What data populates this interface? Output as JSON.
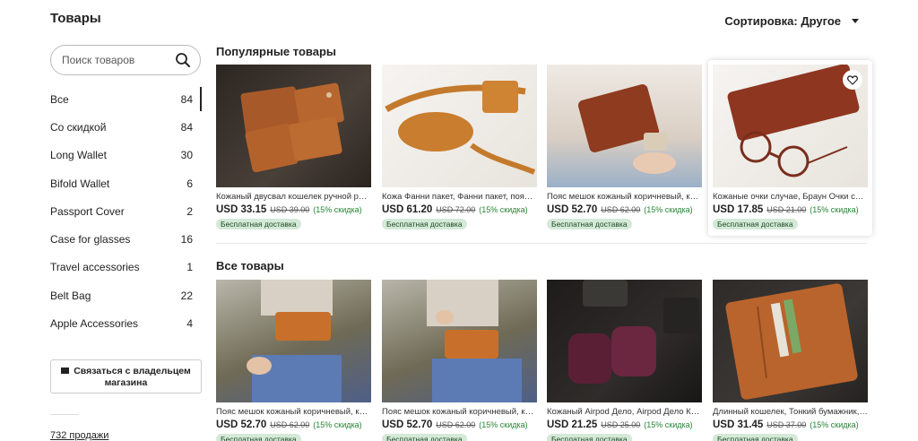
{
  "header": {
    "title": "Товары",
    "sort_label": "Сортировка: Другое"
  },
  "search": {
    "placeholder": "Поиск товаров"
  },
  "categories": [
    {
      "name": "Все",
      "count": "84",
      "active": true
    },
    {
      "name": "Со скидкой",
      "count": "84"
    },
    {
      "name": "Long Wallet",
      "count": "30"
    },
    {
      "name": "Bifold Wallet",
      "count": "6"
    },
    {
      "name": "Passport Cover",
      "count": "2"
    },
    {
      "name": "Case for glasses",
      "count": "16"
    },
    {
      "name": "Travel accessories",
      "count": "1"
    },
    {
      "name": "Belt Bag",
      "count": "22"
    },
    {
      "name": "Apple Accessories",
      "count": "4"
    }
  ],
  "contact": {
    "label": "Связаться с владельцем магазина"
  },
  "sales": {
    "label": "732 продажи"
  },
  "sections": {
    "popular": "Популярные товары",
    "all": "Все товары"
  },
  "popular_items": [
    {
      "title": "Кожаный двусвал кошелек ручной работы",
      "price": "USD 33.15",
      "old_price": "USD 39.00",
      "discount": "(15% скидка)",
      "badge": "Бесплатная доставка"
    },
    {
      "title": "Кожа Фанни пакет, Фанни пакет, пояс сумка",
      "price": "USD 61.20",
      "old_price": "USD 72.00",
      "discount": "(15% скидка)",
      "badge": "Бесплатная доставка"
    },
    {
      "title": "Пояс мешок кожаный коричневый, кожаный",
      "price": "USD 52.70",
      "old_price": "USD 62.00",
      "discount": "(15% скидка)",
      "badge": "Бесплатная доставка"
    },
    {
      "title": "Кожаные очки случае, Браун Очки случае",
      "price": "USD 17.85",
      "old_price": "USD 21.00",
      "discount": "(15% скидка)",
      "badge": "Бесплатная доставка"
    }
  ],
  "all_items": [
    {
      "title": "Пояс мешок кожаный коричневый, кожаный",
      "price": "USD 52.70",
      "old_price": "USD 62.00",
      "discount": "(15% скидка)",
      "badge": "Бесплатная доставка"
    },
    {
      "title": "Пояс мешок кожаный коричневый, кожаный",
      "price": "USD 52.70",
      "old_price": "USD 62.00",
      "discount": "(15% скидка)",
      "badge": "Бесплатная доставка"
    },
    {
      "title": "Кожаный Airpod Дело, Airpod Дело Кожаный",
      "price": "USD 21.25",
      "old_price": "USD 25.00",
      "discount": "(15% скидка)",
      "badge": "Бесплатная доставка"
    },
    {
      "title": "Длинный кошелек, Тонкий бумажник, Кожаный",
      "price": "USD 31.45",
      "old_price": "USD 37.00",
      "discount": "(15% скидка)",
      "badge": "Бесплатная доставка"
    }
  ]
}
